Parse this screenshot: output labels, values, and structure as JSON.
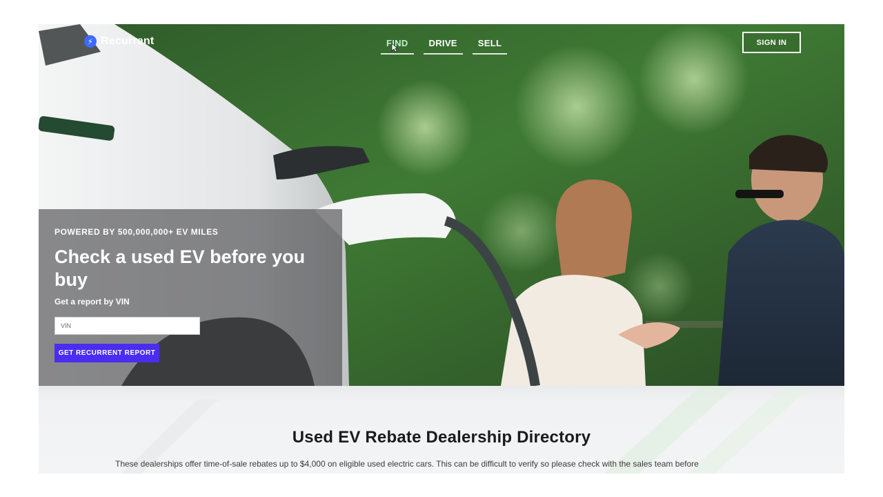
{
  "brand": {
    "name": "Recurrent",
    "logo_icon": "bolt-icon",
    "accent": "#3d6bff"
  },
  "nav": {
    "items": [
      {
        "label": "FIND",
        "active": true
      },
      {
        "label": "DRIVE",
        "active": false
      },
      {
        "label": "SELL",
        "active": false
      }
    ],
    "signin_label": "SIGN IN"
  },
  "hero": {
    "eyebrow": "POWERED BY 500,000,000+ EV MILES",
    "headline": "Check a used EV before you buy",
    "subhead": "Get a report by VIN",
    "vin_placeholder": "VIN",
    "vin_value": "",
    "cta_label": "GET RECURRENT REPORT",
    "cta_color": "#4a2df0"
  },
  "directory": {
    "title": "Used EV Rebate Dealership Directory",
    "description": "These dealerships offer time-of-sale rebates up to $4,000 on eligible used electric cars. This can be difficult to verify so please check with the sales team before"
  }
}
